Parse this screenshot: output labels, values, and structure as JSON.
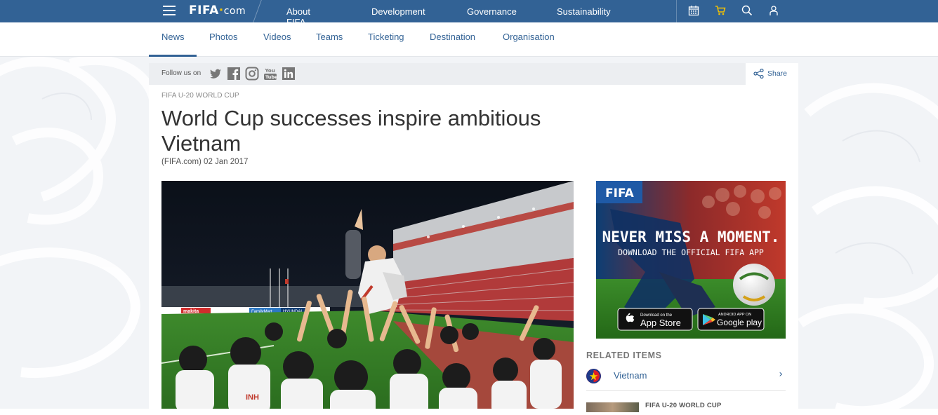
{
  "topbar": {
    "logo_main": "FIFA",
    "logo_dot": "·",
    "logo_suffix": "com",
    "nav": [
      "About FIFA",
      "Development",
      "Governance",
      "Sustainability"
    ],
    "icons": [
      "calendar-icon",
      "cart-icon",
      "search-icon",
      "user-icon"
    ],
    "background_color": "#326295",
    "cart_color": "#f5c200"
  },
  "subnav": {
    "tabs": [
      "News",
      "Photos",
      "Videos",
      "Teams",
      "Ticketing",
      "Destination",
      "Organisation"
    ],
    "active": "News"
  },
  "social": {
    "label": "Follow us on",
    "networks": [
      "twitter-icon",
      "facebook-icon",
      "instagram-icon",
      "youtube-icon",
      "linkedin-icon"
    ]
  },
  "share": {
    "label": "Share"
  },
  "article": {
    "kicker": "FIFA U-20 WORLD CUP",
    "title": "World Cup successes inspire ambitious Vietnam",
    "byline": "(FIFA.com) 02 Jan 2017"
  },
  "ad": {
    "brand": "FIFA",
    "headline": "NEVER MISS A MOMENT.",
    "subline": "DOWNLOAD THE OFFICIAL FIFA APP",
    "appstore_small": "Download on the",
    "appstore_big": "App Store",
    "google_small": "ANDROID APP ON",
    "google_big": "Google play"
  },
  "related": {
    "title": "RELATED ITEMS",
    "items": [
      {
        "label": "Vietnam"
      },
      {
        "label": "FIFA U-20 WORLD CUP"
      }
    ]
  },
  "photo": {
    "banner_text": [
      "makita",
      "FamilyMart",
      "HYUNDAI"
    ],
    "shirt_text": "INH"
  }
}
